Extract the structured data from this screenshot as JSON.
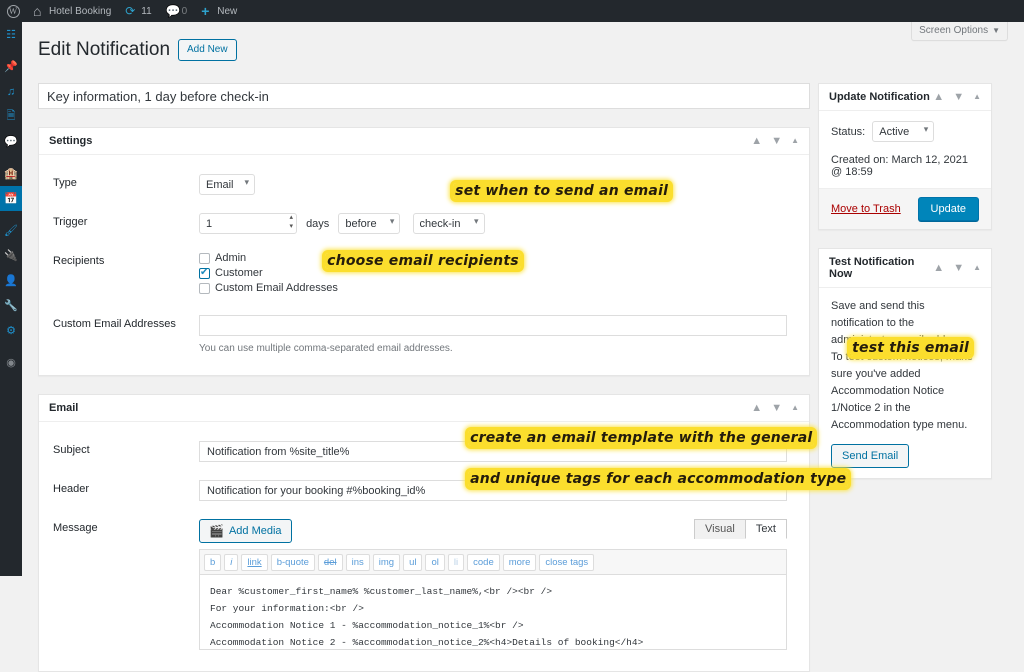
{
  "adminbar": {
    "logo_icon": "wordpress-logo-icon",
    "site_name": "Hotel Booking",
    "home_icon": "home-icon",
    "updates_icon": "updates-refresh-icon",
    "updates_count": "11",
    "comments_icon": "comments-bubble-icon",
    "comments_count": "0",
    "new_icon": "plus-icon",
    "new_label": "New"
  },
  "adminmenu": {
    "items": [
      {
        "name": "dashboard",
        "icon": "dashboard-icon",
        "glyph": "⌂",
        "current": false
      },
      {
        "name": "posts",
        "icon": "pin-icon",
        "glyph": "✒",
        "current": false
      },
      {
        "name": "media",
        "icon": "media-icon",
        "glyph": "♫",
        "current": false
      },
      {
        "name": "pages",
        "icon": "pages-icon",
        "glyph": "❐",
        "current": false
      },
      {
        "name": "comments",
        "icon": "comments-bubble-icon",
        "glyph": "⬛",
        "current": false
      },
      {
        "name": "accommodations",
        "icon": "building-icon",
        "glyph": "▦",
        "current": false
      },
      {
        "name": "bookings",
        "icon": "calendar-icon",
        "glyph": "▤",
        "current": true
      },
      {
        "name": "appearance",
        "icon": "paintbrush-icon",
        "glyph": "✒",
        "current": false
      },
      {
        "name": "plugins",
        "icon": "plugin-icon",
        "glyph": "✇",
        "current": false
      },
      {
        "name": "users",
        "icon": "user-icon",
        "glyph": "☻",
        "current": false
      },
      {
        "name": "tools",
        "icon": "wrench-icon",
        "glyph": "⚒",
        "current": false
      },
      {
        "name": "settings",
        "icon": "settings-sliders-icon",
        "glyph": "⚙",
        "current": false
      },
      {
        "name": "collapse-menu",
        "icon": "collapse-icon",
        "glyph": "◉",
        "current": false
      }
    ]
  },
  "screen_meta": {
    "screen_options_label": "Screen Options",
    "caret_icon": "chevron-down-icon"
  },
  "page": {
    "title": "Edit Notification",
    "add_new_label": "Add New",
    "notification_title": "Key information, 1 day before check-in"
  },
  "panel_controls": {
    "move_up_icon": "chevron-up-icon",
    "move_down_icon": "chevron-down-icon",
    "toggle_icon": "collapse-panel-icon"
  },
  "settings_box": {
    "title": "Settings",
    "rows": {
      "type": {
        "label": "Type",
        "value": "Email"
      },
      "trigger": {
        "label": "Trigger",
        "days_value": "1",
        "days_label": "days",
        "when_value": "before",
        "event_value": "check-in"
      },
      "recipients": {
        "label": "Recipients",
        "options": [
          {
            "label": "Admin",
            "checked": false
          },
          {
            "label": "Customer",
            "checked": true
          },
          {
            "label": "Custom Email Addresses",
            "checked": false
          }
        ]
      },
      "custom_emails": {
        "label": "Custom Email Addresses",
        "value": "",
        "placeholder": "",
        "description": "You can use multiple comma-separated email addresses."
      }
    }
  },
  "email_box": {
    "title": "Email",
    "subject": {
      "label": "Subject",
      "value": "Notification from %site_title%"
    },
    "header": {
      "label": "Header",
      "value": "Notification for your booking #%booking_id%"
    },
    "message": {
      "label": "Message",
      "add_media_label": "Add Media",
      "add_media_icon": "media-add-icon",
      "tabs": [
        {
          "label": "Visual",
          "active": false
        },
        {
          "label": "Text",
          "active": true
        }
      ],
      "quicktags": [
        "b",
        "i",
        "link",
        "b-quote",
        "del",
        "ins",
        "img",
        "ul",
        "ol",
        "li",
        "code",
        "more",
        "close tags"
      ],
      "content": "Dear %customer_first_name% %customer_last_name%,<br /><br />\nFor your information:<br />\nAccommodation Notice 1 - %accommodation_notice_1%<br />\nAccommodation Notice 2 - %accommodation_notice_2%<h4>Details of booking</h4>\nCheck-in: %check_in_date%, from %check_in_time%<br />"
    }
  },
  "update_box": {
    "title": "Update Notification",
    "status_label": "Status:",
    "status_value": "Active",
    "created_label": "Created on: March 12, 2021 @ 18:59",
    "trash_label": "Move to Trash",
    "update_label": "Update"
  },
  "test_box": {
    "title": "Test Notification Now",
    "description": "Save and send this notification to the administrator email address. To test custom notices, make sure you've added Accommodation Notice 1/Notice 2 in the Accommodation type menu.",
    "send_label": "Send Email"
  },
  "annotations": {
    "trigger": "set when to send an email",
    "recipients": "choose email recipients",
    "template_line1": "create an email template with the general",
    "template_line2": "and unique tags for each accommodation type",
    "test": "test this email"
  },
  "colors": {
    "admin_bar": "#23282d",
    "menu_current": "#0073aa",
    "primary_button": "#0085ba",
    "link": "#0071a1",
    "trash_link": "#a00",
    "highlight": "#fbde2d",
    "body_bg": "#f1f1f1"
  }
}
